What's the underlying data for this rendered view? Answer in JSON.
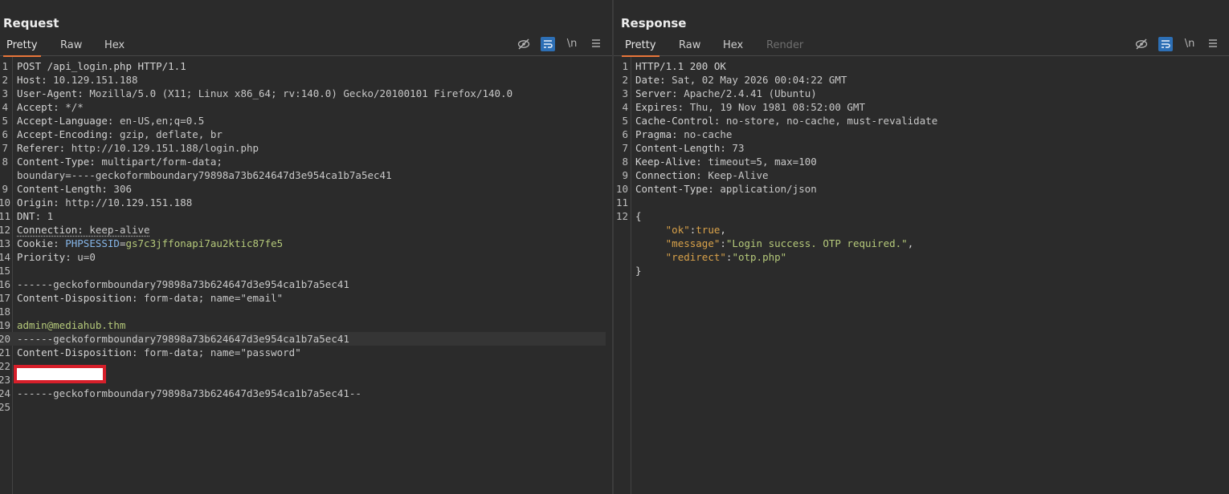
{
  "request": {
    "title": "Request",
    "tabs": [
      "Pretty",
      "Raw",
      "Hex"
    ],
    "active_tab": "Pretty",
    "tools": {
      "hide_icon": "eye-off-icon",
      "wrap_icon": "wrap-lines-icon",
      "newline_label": "\\n",
      "menu_icon": "menu-icon"
    },
    "lines": [
      {
        "n": "1",
        "parts": [
          {
            "t": "POST /api_login.php HTTP/1.1",
            "c": "k"
          }
        ]
      },
      {
        "n": "2",
        "parts": [
          {
            "t": "Host: ",
            "c": "k"
          },
          {
            "t": "10.129.151.188",
            "c": "v"
          }
        ]
      },
      {
        "n": "3",
        "parts": [
          {
            "t": "User-Agent: ",
            "c": "k"
          },
          {
            "t": "Mozilla/5.0 (X11; Linux x86_64; rv:140.0) Gecko/20100101 Firefox/140.0",
            "c": "v"
          }
        ]
      },
      {
        "n": "4",
        "parts": [
          {
            "t": "Accept: ",
            "c": "k"
          },
          {
            "t": "*/*",
            "c": "v"
          }
        ]
      },
      {
        "n": "5",
        "parts": [
          {
            "t": "Accept-Language: ",
            "c": "k"
          },
          {
            "t": "en-US,en;q=0.5",
            "c": "v"
          }
        ]
      },
      {
        "n": "6",
        "parts": [
          {
            "t": "Accept-Encoding: ",
            "c": "k"
          },
          {
            "t": "gzip, deflate, br",
            "c": "v"
          }
        ]
      },
      {
        "n": "7",
        "parts": [
          {
            "t": "Referer: ",
            "c": "k"
          },
          {
            "t": "http://10.129.151.188/login.php",
            "c": "v"
          }
        ]
      },
      {
        "n": "8",
        "parts": [
          {
            "t": "Content-Type: ",
            "c": "k"
          },
          {
            "t": "multipart/form-data;",
            "c": "v"
          }
        ]
      },
      {
        "n": "",
        "parts": [
          {
            "t": "boundary=----geckoformboundary79898a73b624647d3e954ca1b7a5ec41",
            "c": "v"
          }
        ]
      },
      {
        "n": "9",
        "parts": [
          {
            "t": "Content-Length: ",
            "c": "k"
          },
          {
            "t": "306",
            "c": "v"
          }
        ]
      },
      {
        "n": "10",
        "parts": [
          {
            "t": "Origin: ",
            "c": "k"
          },
          {
            "t": "http://10.129.151.188",
            "c": "v"
          }
        ]
      },
      {
        "n": "11",
        "parts": [
          {
            "t": "DNT: ",
            "c": "k"
          },
          {
            "t": "1",
            "c": "v"
          }
        ]
      },
      {
        "n": "12",
        "parts": [
          {
            "t": "Connection: ",
            "c": "k ul"
          },
          {
            "t": "keep-alive",
            "c": "v ul"
          }
        ]
      },
      {
        "n": "13",
        "parts": [
          {
            "t": "Cookie: ",
            "c": "k"
          },
          {
            "t": "PHPSESSID",
            "c": "param"
          },
          {
            "t": "=",
            "c": "k"
          },
          {
            "t": "gs7c3jffonapi7au2ktic87fe5",
            "c": "green"
          }
        ]
      },
      {
        "n": "14",
        "parts": [
          {
            "t": "Priority: ",
            "c": "k"
          },
          {
            "t": "u=0",
            "c": "v"
          }
        ]
      },
      {
        "n": "15",
        "parts": []
      },
      {
        "n": "16",
        "parts": [
          {
            "t": "------geckoformboundary79898a73b624647d3e954ca1b7a5ec41",
            "c": "v"
          }
        ]
      },
      {
        "n": "17",
        "parts": [
          {
            "t": "Content-Disposition: ",
            "c": "k"
          },
          {
            "t": "form-data; name=",
            "c": "v"
          },
          {
            "t": "\"email\"",
            "c": "v"
          }
        ]
      },
      {
        "n": "18",
        "parts": []
      },
      {
        "n": "19",
        "parts": [
          {
            "t": "admin@mediahub.thm",
            "c": "green"
          }
        ]
      },
      {
        "n": "20",
        "parts": [
          {
            "t": "------geckoformboundary79898a73b624647d3e954ca1b7a5ec41",
            "c": "v"
          }
        ],
        "hl": true
      },
      {
        "n": "21",
        "parts": [
          {
            "t": "Content-Disposition: ",
            "c": "k"
          },
          {
            "t": "form-data; name=",
            "c": "v"
          },
          {
            "t": "\"password\"",
            "c": "v"
          }
        ]
      },
      {
        "n": "22",
        "parts": []
      },
      {
        "n": "23",
        "parts": []
      },
      {
        "n": "24",
        "parts": [
          {
            "t": "------geckoformboundary79898a73b624647d3e954ca1b7a5ec41--",
            "c": "v"
          }
        ]
      },
      {
        "n": "25",
        "parts": []
      }
    ]
  },
  "response": {
    "title": "Response",
    "tabs": [
      "Pretty",
      "Raw",
      "Hex",
      "Render"
    ],
    "active_tab": "Pretty",
    "tools": {
      "hide_icon": "eye-off-icon",
      "wrap_icon": "wrap-lines-icon",
      "newline_label": "\\n",
      "menu_icon": "menu-icon"
    },
    "lines": [
      {
        "n": "1",
        "parts": [
          {
            "t": "HTTP/1.1 200 OK",
            "c": "k"
          }
        ]
      },
      {
        "n": "2",
        "parts": [
          {
            "t": "Date: ",
            "c": "k"
          },
          {
            "t": "Sat, 02 May 2026 00:04:22 GMT",
            "c": "v"
          }
        ]
      },
      {
        "n": "3",
        "parts": [
          {
            "t": "Server: ",
            "c": "k"
          },
          {
            "t": "Apache/2.4.41 (Ubuntu)",
            "c": "v"
          }
        ]
      },
      {
        "n": "4",
        "parts": [
          {
            "t": "Expires: ",
            "c": "k"
          },
          {
            "t": "Thu, 19 Nov 1981 08:52:00 GMT",
            "c": "v"
          }
        ]
      },
      {
        "n": "5",
        "parts": [
          {
            "t": "Cache-Control: ",
            "c": "k"
          },
          {
            "t": "no-store, no-cache, must-revalidate",
            "c": "v"
          }
        ]
      },
      {
        "n": "6",
        "parts": [
          {
            "t": "Pragma: ",
            "c": "k"
          },
          {
            "t": "no-cache",
            "c": "v"
          }
        ]
      },
      {
        "n": "7",
        "parts": [
          {
            "t": "Content-Length: ",
            "c": "k"
          },
          {
            "t": "73",
            "c": "v"
          }
        ]
      },
      {
        "n": "8",
        "parts": [
          {
            "t": "Keep-Alive: ",
            "c": "k"
          },
          {
            "t": "timeout=5, max=100",
            "c": "v"
          }
        ]
      },
      {
        "n": "9",
        "parts": [
          {
            "t": "Connection: ",
            "c": "k"
          },
          {
            "t": "Keep-Alive",
            "c": "v"
          }
        ]
      },
      {
        "n": "10",
        "parts": [
          {
            "t": "Content-Type: ",
            "c": "k"
          },
          {
            "t": "application/json",
            "c": "v"
          }
        ]
      },
      {
        "n": "11",
        "parts": []
      },
      {
        "n": "12",
        "parts": [
          {
            "t": "{",
            "c": "k"
          }
        ]
      },
      {
        "n": "",
        "parts": [
          {
            "t": "     ",
            "c": "k"
          },
          {
            "t": "\"ok\"",
            "c": "jk"
          },
          {
            "t": ":",
            "c": "k"
          },
          {
            "t": "true",
            "c": "jk"
          },
          {
            "t": ",",
            "c": "k"
          }
        ]
      },
      {
        "n": "",
        "parts": [
          {
            "t": "     ",
            "c": "k"
          },
          {
            "t": "\"message\"",
            "c": "jk"
          },
          {
            "t": ":",
            "c": "k"
          },
          {
            "t": "\"Login success. OTP required.\"",
            "c": "jv"
          },
          {
            "t": ",",
            "c": "k"
          }
        ]
      },
      {
        "n": "",
        "parts": [
          {
            "t": "     ",
            "c": "k"
          },
          {
            "t": "\"redirect\"",
            "c": "jk"
          },
          {
            "t": ":",
            "c": "k"
          },
          {
            "t": "\"otp.php\"",
            "c": "jv"
          }
        ]
      },
      {
        "n": "",
        "parts": [
          {
            "t": "}",
            "c": "k"
          }
        ]
      }
    ]
  },
  "colors": {
    "accent": "#e8763a",
    "selected_tool": "#2d6fb5",
    "redaction": "#d61f2a"
  },
  "layout_buttons": [
    "columns-layout-icon",
    "rows-layout-icon",
    "single-pane-icon"
  ]
}
